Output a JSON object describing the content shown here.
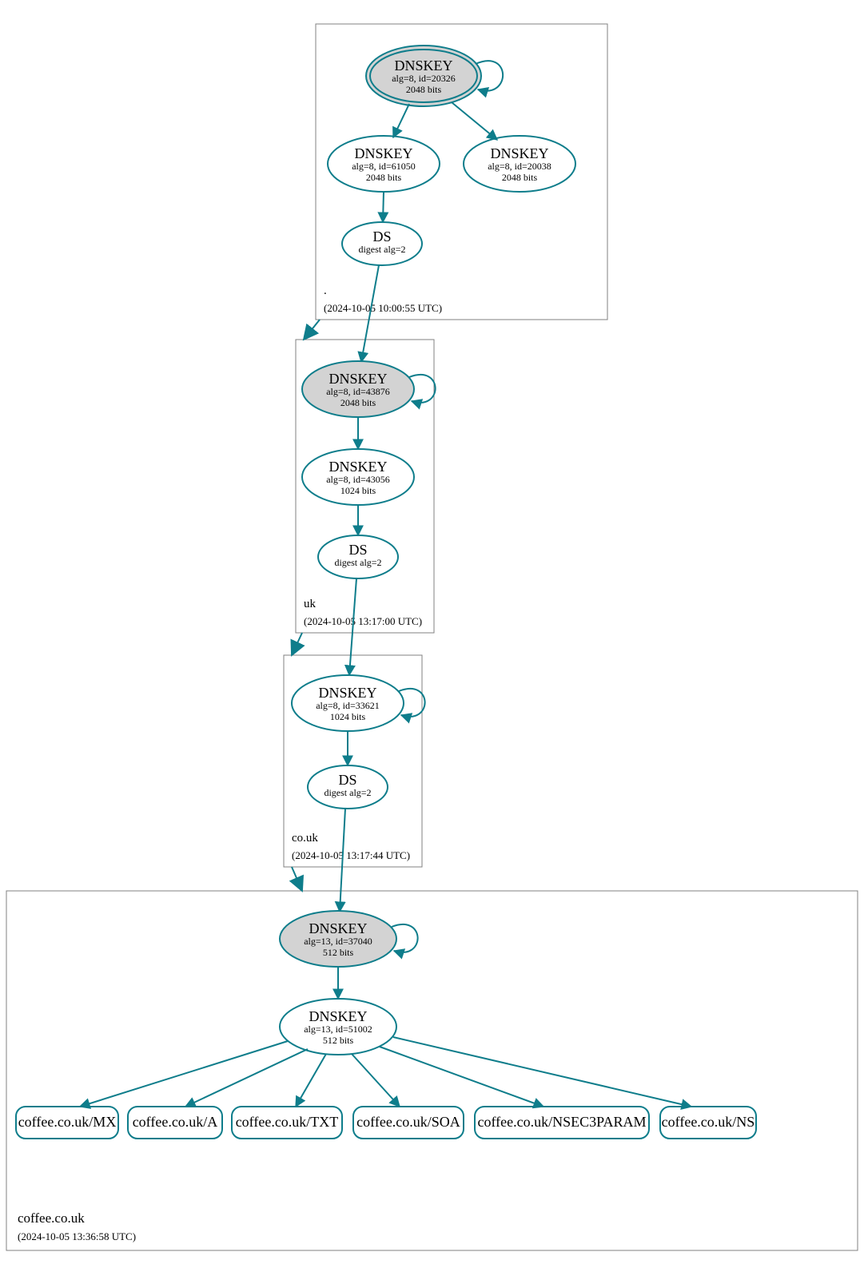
{
  "colors": {
    "stroke": "#0e7d8b",
    "fillGrey": "#d3d3d3",
    "fillWhite": "#ffffff"
  },
  "zones": {
    "root": {
      "name": ".",
      "timestamp": "(2024-10-05 10:00:55 UTC)"
    },
    "uk": {
      "name": "uk",
      "timestamp": "(2024-10-05 13:17:00 UTC)"
    },
    "couk": {
      "name": "co.uk",
      "timestamp": "(2024-10-05 13:17:44 UTC)"
    },
    "domain": {
      "name": "coffee.co.uk",
      "timestamp": "(2024-10-05 13:36:58 UTC)"
    }
  },
  "nodes": {
    "root_ksk": {
      "title": "DNSKEY",
      "l2": "alg=8, id=20326",
      "l3": "2048 bits"
    },
    "root_zsk1": {
      "title": "DNSKEY",
      "l2": "alg=8, id=61050",
      "l3": "2048 bits"
    },
    "root_zsk2": {
      "title": "DNSKEY",
      "l2": "alg=8, id=20038",
      "l3": "2048 bits"
    },
    "root_ds": {
      "title": "DS",
      "l2": "digest alg=2",
      "l3": ""
    },
    "uk_ksk": {
      "title": "DNSKEY",
      "l2": "alg=8, id=43876",
      "l3": "2048 bits"
    },
    "uk_zsk": {
      "title": "DNSKEY",
      "l2": "alg=8, id=43056",
      "l3": "1024 bits"
    },
    "uk_ds": {
      "title": "DS",
      "l2": "digest alg=2",
      "l3": ""
    },
    "couk_key": {
      "title": "DNSKEY",
      "l2": "alg=8, id=33621",
      "l3": "1024 bits"
    },
    "couk_ds": {
      "title": "DS",
      "l2": "digest alg=2",
      "l3": ""
    },
    "dom_ksk": {
      "title": "DNSKEY",
      "l2": "alg=13, id=37040",
      "l3": "512 bits"
    },
    "dom_zsk": {
      "title": "DNSKEY",
      "l2": "alg=13, id=51002",
      "l3": "512 bits"
    }
  },
  "rr": {
    "mx": "coffee.co.uk/MX",
    "a": "coffee.co.uk/A",
    "txt": "coffee.co.uk/TXT",
    "soa": "coffee.co.uk/SOA",
    "nsec": "coffee.co.uk/NSEC3PARAM",
    "ns": "coffee.co.uk/NS"
  }
}
